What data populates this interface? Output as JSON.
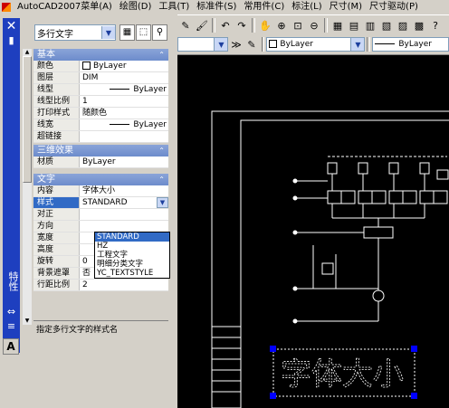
{
  "menubar": {
    "items": [
      "AutoCAD2007菜单(A)",
      "绘图(D)",
      "工具(T)",
      "标准件(S)",
      "常用件(C)",
      "标注(L)",
      "尺寸(M)",
      "尺寸驱动(P)"
    ]
  },
  "toolbar2": {
    "combo_value": "ByLayer"
  },
  "palette": {
    "title": "特性",
    "object_type": "多行文字",
    "categories": {
      "basic": "基本",
      "three_d": "三维效果",
      "text": "文字"
    },
    "basic_rows": [
      {
        "key": "颜色",
        "value": "ByLayer"
      },
      {
        "key": "图层",
        "value": "DIM"
      },
      {
        "key": "线型",
        "value": "ByLayer"
      },
      {
        "key": "线型比例",
        "value": "1"
      },
      {
        "key": "打印样式",
        "value": "随颜色"
      },
      {
        "key": "线宽",
        "value": "ByLayer"
      },
      {
        "key": "超链接",
        "value": ""
      }
    ],
    "three_d_rows": [
      {
        "key": "材质",
        "value": "ByLayer"
      }
    ],
    "text_rows": [
      {
        "key": "内容",
        "value": "字体大小"
      },
      {
        "key": "样式",
        "value": "STANDARD"
      },
      {
        "key": "对正",
        "value": ""
      },
      {
        "key": "方向",
        "value": ""
      },
      {
        "key": "宽度",
        "value": ""
      },
      {
        "key": "高度",
        "value": ""
      },
      {
        "key": "旋转",
        "value": "0"
      },
      {
        "key": "背景遮罩",
        "value": "否"
      },
      {
        "key": "行距比例",
        "value": "2"
      }
    ],
    "style_options": [
      "STANDARD",
      "HZ",
      "工程文字",
      "明细分类文字",
      "YC_TEXTSTYLE"
    ],
    "selected_option": "STANDARD",
    "description": "指定多行文字的样式名"
  },
  "drawing": {
    "mtext_content": "字体大小"
  },
  "colors": {
    "titlebar": "#1e3fbf",
    "selection": "#316ac5",
    "grip": "#0000ff",
    "canvas": "#000000"
  }
}
